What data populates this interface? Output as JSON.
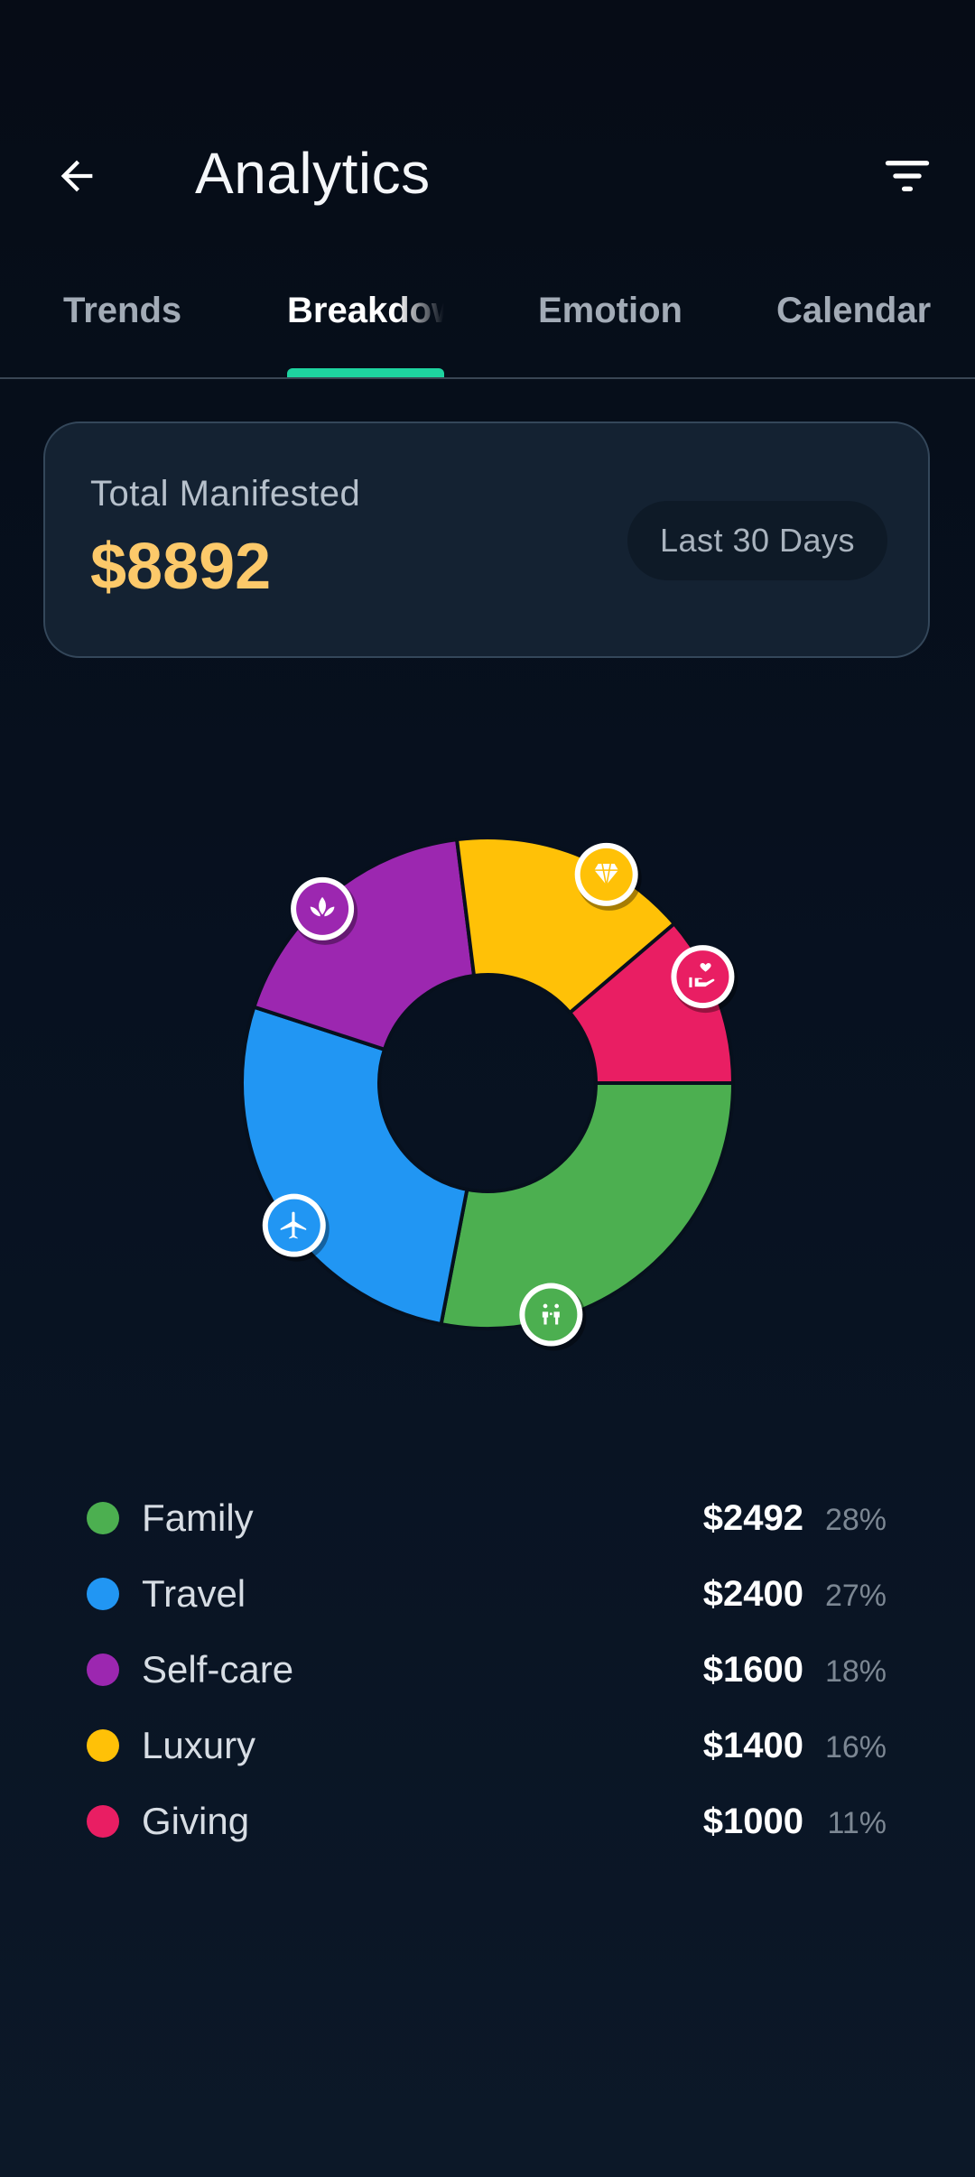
{
  "app_bar": {
    "title": "Analytics",
    "back_icon": "arrow-left-icon",
    "filter_icon": "filter-icon"
  },
  "tabs": [
    {
      "label": "Trends",
      "active": false
    },
    {
      "label": "Breakdown",
      "active": true
    },
    {
      "label": "Emotion",
      "active": false
    },
    {
      "label": "Calendar",
      "active": false
    }
  ],
  "summary": {
    "label": "Total Manifested",
    "amount": "$8892",
    "period": "Last 30 Days"
  },
  "colors": {
    "accent": "#1ed3a0",
    "amount": "#fcc96a",
    "family": "#4caf50",
    "travel": "#2196f3",
    "self_care": "#9c27b0",
    "luxury": "#ffc107",
    "giving": "#e91e63"
  },
  "chart_data": {
    "type": "pie",
    "donut": true,
    "slices": [
      {
        "label": "Family",
        "value": 2492,
        "percent": 28,
        "color": "#4caf50",
        "icon": "family-icon"
      },
      {
        "label": "Travel",
        "value": 2400,
        "percent": 27,
        "color": "#2196f3",
        "icon": "airplane-icon"
      },
      {
        "label": "Self-care",
        "value": 1600,
        "percent": 18,
        "color": "#9c27b0",
        "icon": "lotus-icon"
      },
      {
        "label": "Luxury",
        "value": 1400,
        "percent": 16,
        "color": "#ffc107",
        "icon": "diamond-icon"
      },
      {
        "label": "Giving",
        "value": 1000,
        "percent": 11,
        "color": "#e91e63",
        "icon": "heart-hand-icon"
      }
    ],
    "start_angle_deg": 0,
    "direction": "clockwise"
  },
  "legend": [
    {
      "name": "Family",
      "amount": "$2492",
      "percent": "28%",
      "color": "#4caf50"
    },
    {
      "name": "Travel",
      "amount": "$2400",
      "percent": "27%",
      "color": "#2196f3"
    },
    {
      "name": "Self-care",
      "amount": "$1600",
      "percent": "18%",
      "color": "#9c27b0"
    },
    {
      "name": "Luxury",
      "amount": "$1400",
      "percent": "16%",
      "color": "#ffc107"
    },
    {
      "name": "Giving",
      "amount": "$1000",
      "percent": "11%",
      "color": "#e91e63"
    }
  ]
}
